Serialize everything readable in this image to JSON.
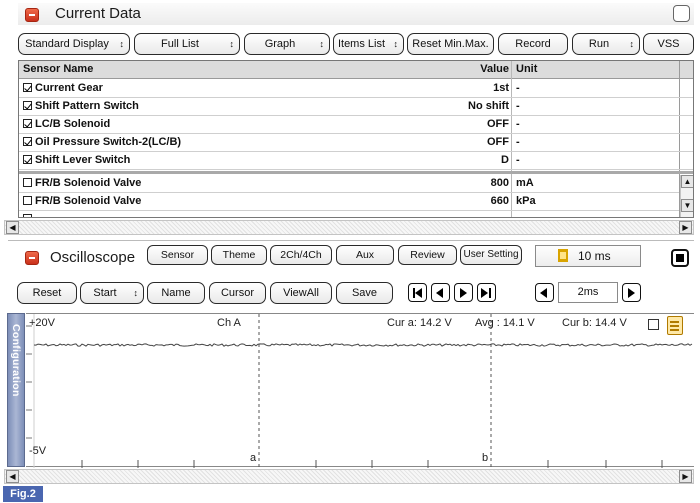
{
  "current_data": {
    "title": "Current Data",
    "toolbar": {
      "standard_display": "Standard Display",
      "full_list": "Full List",
      "graph": "Graph",
      "items_list": "Items List",
      "reset_min_max": "Reset Min.Max.",
      "record": "Record",
      "run": "Run",
      "vss": "VSS"
    },
    "table": {
      "headers": {
        "name": "Sensor Name",
        "value": "Value",
        "unit": "Unit"
      },
      "rows": [
        {
          "name": "Current Gear",
          "value": "1st",
          "unit": "-",
          "checked": true
        },
        {
          "name": "Shift Pattern Switch",
          "value": "No shift",
          "unit": "-",
          "checked": true
        },
        {
          "name": "LC/B Solenoid",
          "value": "OFF",
          "unit": "-",
          "checked": true
        },
        {
          "name": "Oil Pressure Switch-2(LC/B)",
          "value": "OFF",
          "unit": "-",
          "checked": true
        },
        {
          "name": "Shift Lever Switch",
          "value": "D",
          "unit": "-",
          "checked": true
        },
        {
          "name": "FR/B Solenoid Valve",
          "value": "800",
          "unit": "mA",
          "checked": false
        },
        {
          "name": "FR/B Solenoid Valve",
          "value": "660",
          "unit": "kPa",
          "checked": false
        }
      ]
    }
  },
  "oscilloscope": {
    "title": "Oscilloscope",
    "top_buttons": {
      "sensor": "Sensor",
      "theme": "Theme",
      "channels": "2Ch/4Ch",
      "aux": "Aux",
      "review": "Review",
      "user_setting": "User Setting"
    },
    "timebase_readout": "10 ms",
    "controls": {
      "reset": "Reset",
      "start": "Start",
      "name": "Name",
      "cursor": "Cursor",
      "view_all": "ViewAll",
      "save": "Save"
    },
    "time_div": "2ms",
    "config_tab": "Configuration",
    "plot": {
      "y_max": "+20V",
      "y_min": "-5V",
      "channel": "Ch A",
      "cursor_a": "Cur a: 14.2 V",
      "average": "Avg : 14.1 V",
      "cursor_b": "Cur b: 14.4 V",
      "marker_a": "a",
      "marker_b": "b"
    }
  },
  "figure_label": "Fig.2"
}
